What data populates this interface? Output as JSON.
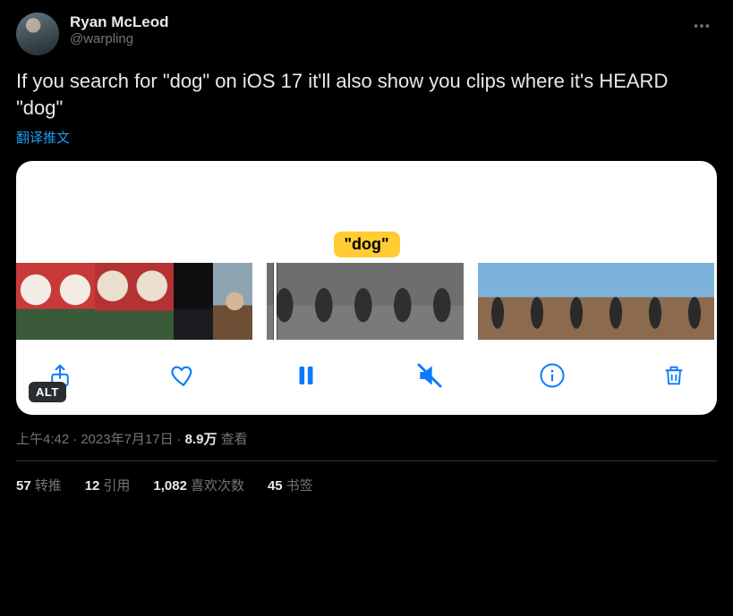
{
  "user": {
    "display_name": "Ryan McLeod",
    "handle": "@warpling"
  },
  "tweet": {
    "text": "If you search for \"dog\" on iOS 17 it'll also show you clips where it's HEARD \"dog\"",
    "translate_label": "翻译推文"
  },
  "media": {
    "search_term": "\"dog\"",
    "alt_badge": "ALT"
  },
  "meta": {
    "time": "上午4:42",
    "date": "2023年7月17日",
    "views_count": "8.9万",
    "views_label": "查看"
  },
  "stats": {
    "retweets": {
      "count": "57",
      "label": "转推"
    },
    "quotes": {
      "count": "12",
      "label": "引用"
    },
    "likes": {
      "count": "1,082",
      "label": "喜欢次数"
    },
    "bookmarks": {
      "count": "45",
      "label": "书签"
    }
  }
}
